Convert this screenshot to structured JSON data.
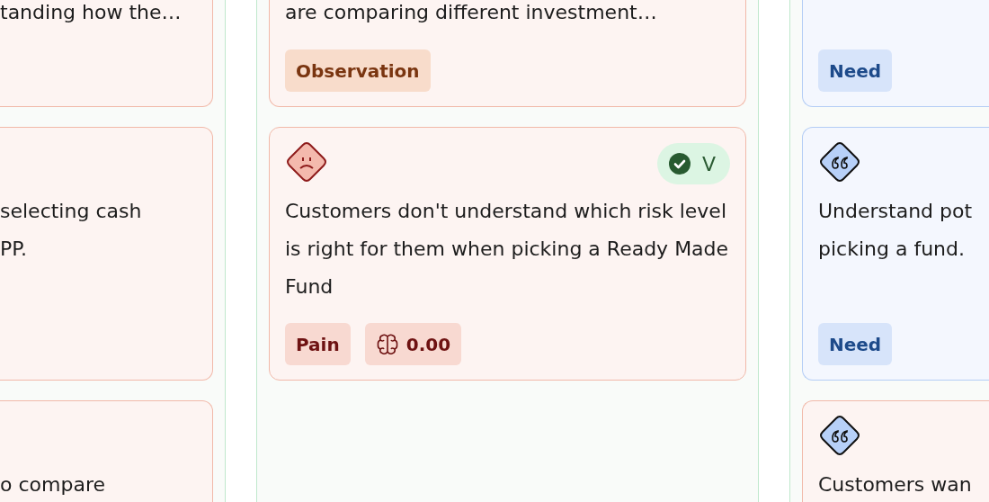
{
  "columns": [
    {
      "cards": [
        {
          "kind": "pain",
          "text": "tanding how the…"
        },
        {
          "kind": "pain",
          "text": "selecting cash\nPP."
        },
        {
          "kind": "pain",
          "text": "o compare"
        }
      ]
    },
    {
      "cards": [
        {
          "kind": "pain",
          "text": "are comparing different investment…",
          "tags": [
            {
              "kind": "observation",
              "label": "Observation"
            }
          ]
        },
        {
          "kind": "pain",
          "badge": {
            "label": "V",
            "verified": true
          },
          "text": "Customers don't understand which risk level is right for them when picking a Ready Made Fund",
          "tags": [
            {
              "kind": "pain",
              "label": "Pain"
            },
            {
              "kind": "score",
              "label": "0.00"
            }
          ]
        }
      ]
    },
    {
      "cards": [
        {
          "kind": "need",
          "tags": [
            {
              "kind": "need",
              "label": "Need"
            }
          ]
        },
        {
          "kind": "need",
          "text": "Understand pot\npicking a fund.",
          "tags": [
            {
              "kind": "need",
              "label": "Need"
            }
          ]
        },
        {
          "kind": "quote",
          "text": "Customers wan"
        }
      ]
    }
  ]
}
